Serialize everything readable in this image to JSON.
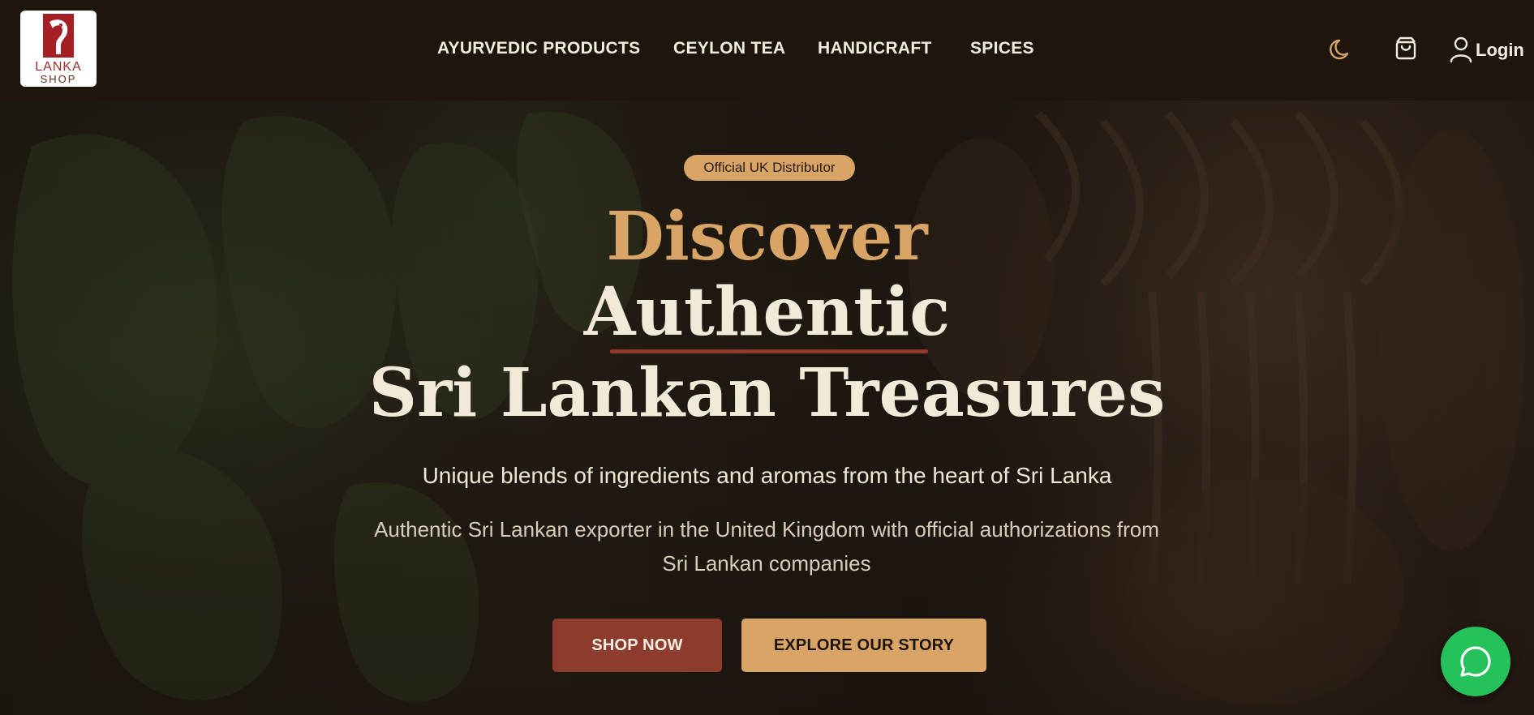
{
  "brand": {
    "name_line1": "LANKA",
    "name_line2": "SHOP"
  },
  "nav": {
    "items": [
      {
        "label": "AYURVEDIC PRODUCTS"
      },
      {
        "label": "CEYLON TEA"
      },
      {
        "label": "HANDICRAFT"
      },
      {
        "label": "SPICES"
      }
    ]
  },
  "header_actions": {
    "theme_icon": "moon-icon",
    "cart_icon": "shopping-bag-icon",
    "user_icon": "user-icon",
    "login_label": "Login"
  },
  "hero": {
    "badge": "Official UK Distributor",
    "heading_line1": "Discover",
    "heading_line2": "Authentic",
    "heading_line3": "Sri Lankan Treasures",
    "tagline": "Unique blends of ingredients and aromas from the heart of Sri Lanka",
    "description": "Authentic Sri Lankan exporter in the United Kingdom with official authorizations from Sri Lankan companies",
    "primary_button": "SHOP NOW",
    "secondary_button": "EXPLORE OUR STORY"
  },
  "chat": {
    "icon": "whatsapp-chat-icon"
  },
  "colors": {
    "accent_gold": "#d9a566",
    "accent_brick": "#8d3b2c",
    "header_bg": "#1e150d",
    "whatsapp_green": "#25c15a",
    "text_light": "#f2ead9"
  }
}
